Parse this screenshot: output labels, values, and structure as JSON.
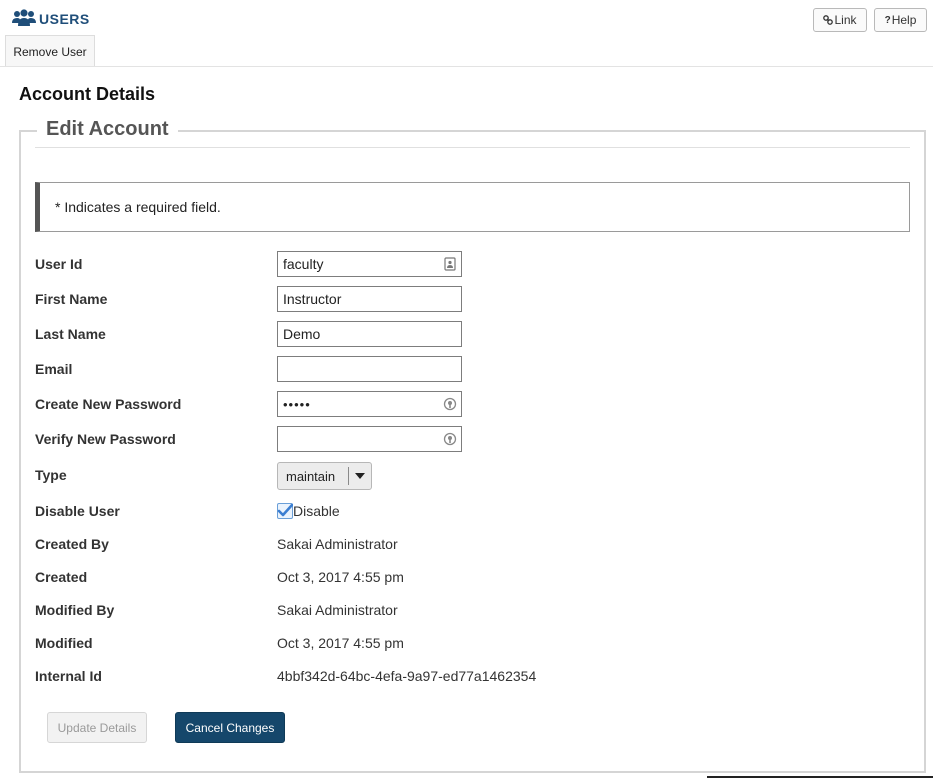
{
  "header": {
    "title": "USERS",
    "link_label": "Link",
    "help_label": "Help",
    "link_icon": "link-icon",
    "help_icon": "help-icon",
    "title_icon": "users-icon",
    "title_color": "#1f4e79"
  },
  "nav": {
    "tab_label": "Remove User"
  },
  "page": {
    "heading": "Account Details",
    "legend": "Edit Account",
    "notice": "* Indicates a required field."
  },
  "form": {
    "user_id": {
      "label": "User Id",
      "value": "faculty"
    },
    "first_name": {
      "label": "First Name",
      "value": "Instructor"
    },
    "last_name": {
      "label": "Last Name",
      "value": "Demo"
    },
    "email": {
      "label": "Email",
      "value": ""
    },
    "new_password": {
      "label": "Create New Password",
      "value": "•••••"
    },
    "verify_password": {
      "label": "Verify New Password",
      "value": ""
    },
    "type": {
      "label": "Type",
      "selected": "maintain"
    },
    "disable_user": {
      "label": "Disable User",
      "checkbox_label": "Disable",
      "checked": true
    },
    "created_by": {
      "label": "Created By",
      "value": "Sakai Administrator"
    },
    "created": {
      "label": "Created",
      "value": "Oct 3, 2017 4:55 pm"
    },
    "modified_by": {
      "label": "Modified By",
      "value": "Sakai Administrator"
    },
    "modified": {
      "label": "Modified",
      "value": "Oct 3, 2017 4:55 pm"
    },
    "internal_id": {
      "label": "Internal Id",
      "value": "4bbf342d-64bc-4efa-9a97-ed77a1462354"
    }
  },
  "actions": {
    "update_label": "Update Details",
    "cancel_label": "Cancel Changes",
    "cancel_color": "#15476b"
  }
}
